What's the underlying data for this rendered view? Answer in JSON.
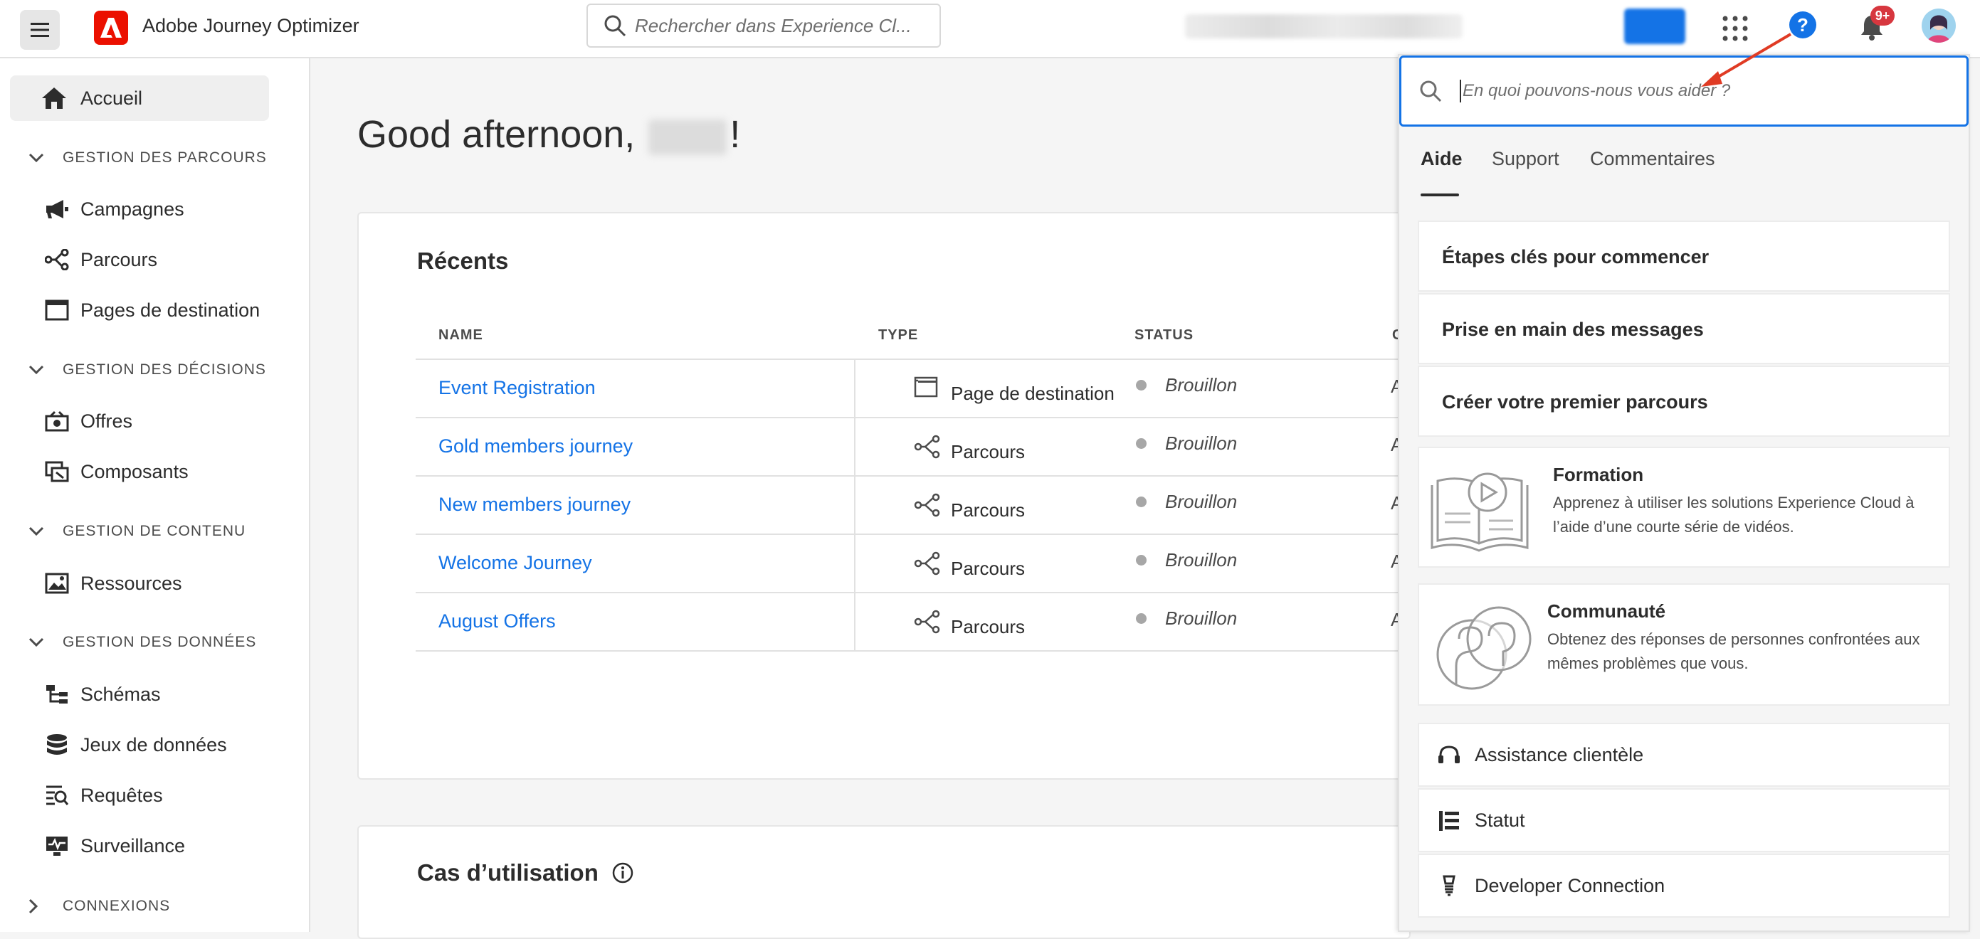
{
  "header": {
    "app_title": "Adobe Journey Optimizer",
    "search_placeholder": "Rechercher dans Experience Cl...",
    "notification_count": "9+",
    "icons": [
      "menu-icon",
      "adobe-logo",
      "search-icon",
      "apps-grid-icon",
      "help-icon",
      "bell-icon",
      "avatar"
    ]
  },
  "sidebar": {
    "home": {
      "label": "Accueil",
      "icon": "home-icon"
    },
    "sections": [
      {
        "label": "GESTION DES PARCOURS",
        "items": [
          {
            "label": "Campagnes",
            "icon": "megaphone-icon"
          },
          {
            "label": "Parcours",
            "icon": "journey-icon"
          },
          {
            "label": "Pages de destination",
            "icon": "landing-page-icon"
          }
        ]
      },
      {
        "label": "GESTION DES DÉCISIONS",
        "items": [
          {
            "label": "Offres",
            "icon": "offers-icon"
          },
          {
            "label": "Composants",
            "icon": "components-icon"
          }
        ]
      },
      {
        "label": "GESTION DE CONTENU",
        "items": [
          {
            "label": "Ressources",
            "icon": "assets-icon"
          }
        ]
      },
      {
        "label": "GESTION DES DONNÉES",
        "items": [
          {
            "label": "Schémas",
            "icon": "schema-icon"
          },
          {
            "label": "Jeux de données",
            "icon": "database-icon"
          },
          {
            "label": "Requêtes",
            "icon": "queries-icon"
          },
          {
            "label": "Surveillance",
            "icon": "monitoring-icon"
          }
        ]
      },
      {
        "label": "CONNEXIONS",
        "items": []
      }
    ]
  },
  "main": {
    "greeting_prefix": "Good afternoon, ",
    "greeting_suffix": "!",
    "recents": {
      "title": "Récents",
      "columns": [
        "NAME",
        "TYPE",
        "STATUS",
        "C"
      ],
      "rows": [
        {
          "name": "Event Registration",
          "type": "Page de destination",
          "status": "Brouillon",
          "extra": "A"
        },
        {
          "name": "Gold members journey",
          "type": "Parcours",
          "status": "Brouillon",
          "extra": "A"
        },
        {
          "name": "New members journey",
          "type": "Parcours",
          "status": "Brouillon",
          "extra": "A"
        },
        {
          "name": "Welcome Journey",
          "type": "Parcours",
          "status": "Brouillon",
          "extra": "A"
        },
        {
          "name": "August Offers",
          "type": "Parcours",
          "status": "Brouillon",
          "extra": "A"
        }
      ]
    },
    "use_cases": {
      "title": "Cas d’utilisation"
    }
  },
  "help_panel": {
    "search_placeholder": "En quoi pouvons-nous vous aider ?",
    "tabs": [
      "Aide",
      "Support",
      "Commentaires"
    ],
    "links": [
      "Étapes clés pour commencer",
      "Prise en main des messages",
      "Créer votre premier parcours"
    ],
    "training": {
      "title": "Formation",
      "description": "Apprenez à utiliser les solutions Experience Cloud à l’aide d’une courte série de vidéos."
    },
    "community": {
      "title": "Communauté",
      "description": "Obtenez des réponses de personnes confrontées aux mêmes problèmes que vous."
    },
    "utilities": [
      {
        "label": "Assistance clientèle",
        "icon": "headset-icon"
      },
      {
        "label": "Statut",
        "icon": "status-icon"
      },
      {
        "label": "Developer Connection",
        "icon": "bulb-icon"
      }
    ]
  },
  "colors": {
    "accent": "#1473e6",
    "brand": "#eb1000",
    "badge": "#d7373f",
    "annotation_arrow": "#e03b24"
  }
}
